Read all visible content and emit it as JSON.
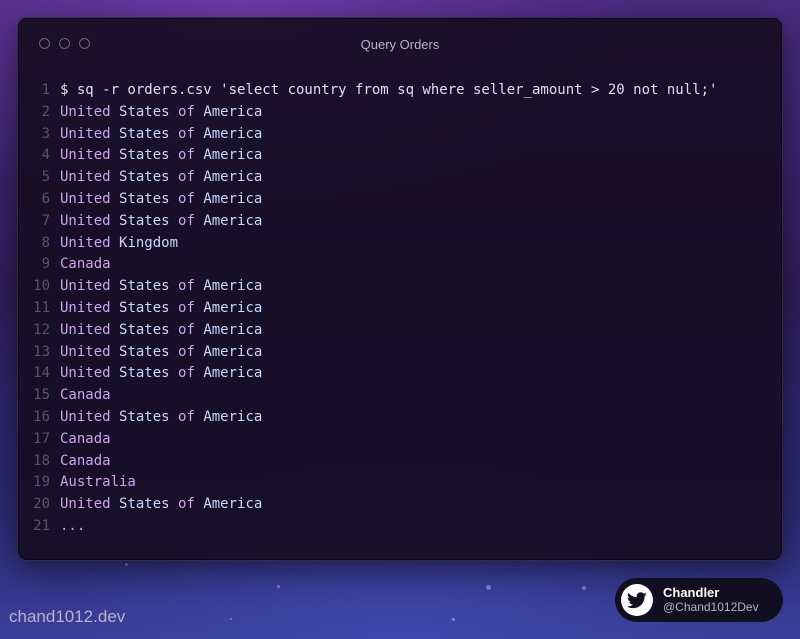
{
  "window": {
    "title": "Query Orders"
  },
  "terminal": {
    "lines": [
      {
        "n": "1",
        "text": "$ sq -r orders.csv 'select country from sq where seller_amount > 20 not null;'"
      },
      {
        "n": "2",
        "text": "United States of America"
      },
      {
        "n": "3",
        "text": "United States of America"
      },
      {
        "n": "4",
        "text": "United States of America"
      },
      {
        "n": "5",
        "text": "United States of America"
      },
      {
        "n": "6",
        "text": "United States of America"
      },
      {
        "n": "7",
        "text": "United States of America"
      },
      {
        "n": "8",
        "text": "United Kingdom"
      },
      {
        "n": "9",
        "text": "Canada"
      },
      {
        "n": "10",
        "text": "United States of America"
      },
      {
        "n": "11",
        "text": "United States of America"
      },
      {
        "n": "12",
        "text": "United States of America"
      },
      {
        "n": "13",
        "text": "United States of America"
      },
      {
        "n": "14",
        "text": "United States of America"
      },
      {
        "n": "15",
        "text": "Canada"
      },
      {
        "n": "16",
        "text": "United States of America"
      },
      {
        "n": "17",
        "text": "Canada"
      },
      {
        "n": "18",
        "text": "Canada"
      },
      {
        "n": "19",
        "text": "Australia"
      },
      {
        "n": "20",
        "text": "United States of America"
      },
      {
        "n": "21",
        "text": "..."
      }
    ]
  },
  "footer": {
    "brand": "chand1012.dev",
    "badge": {
      "icon": "twitter-icon",
      "name": "Chandler",
      "handle": "@Chand1012Dev"
    }
  },
  "colors": {
    "output_primary": "#cfa3f2",
    "output_secondary": "#c9d6ff",
    "command": "#e2dbf5",
    "line_number": "#5a5468"
  }
}
